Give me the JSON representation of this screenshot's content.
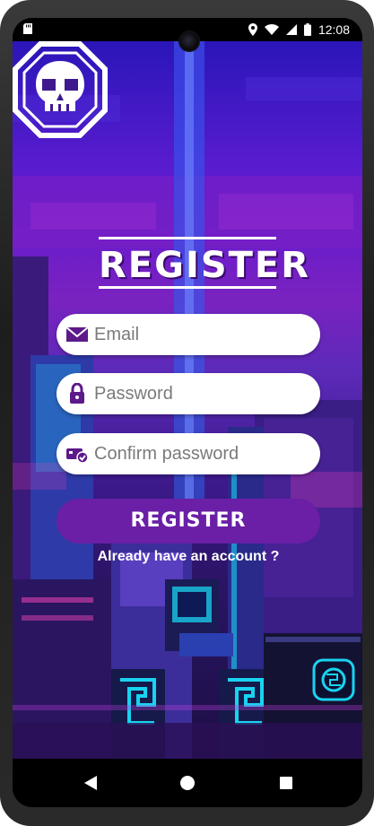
{
  "status_bar": {
    "time": "12:08",
    "icons": [
      "sd-card-icon",
      "location-icon",
      "wifi-icon",
      "signal-icon",
      "battery-icon"
    ]
  },
  "page": {
    "title": "REGISTER"
  },
  "form": {
    "email": {
      "placeholder": "Email",
      "value": "",
      "icon": "mail-icon"
    },
    "password": {
      "placeholder": "Password",
      "value": "",
      "icon": "lock-icon"
    },
    "confirm_password": {
      "placeholder": "Confirm password",
      "value": "",
      "icon": "key-card-icon"
    },
    "submit_label": "REGISTER",
    "login_link": "Already have an account ?"
  },
  "nav_bar": {
    "buttons": [
      "back-icon",
      "home-icon",
      "recents-icon"
    ]
  },
  "colors": {
    "accent": "#6a1fa6",
    "icon": "#5c1a8a",
    "background_top": "#2a16b8",
    "background_bottom": "#1c0f44"
  }
}
